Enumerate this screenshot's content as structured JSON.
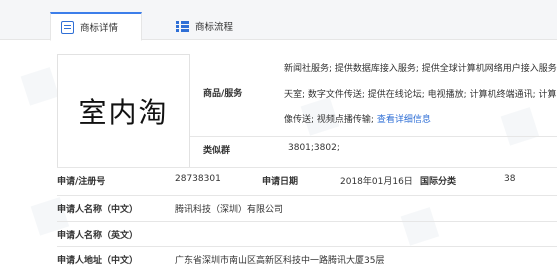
{
  "tabs": [
    {
      "label": "商标详情",
      "icon": "document-icon",
      "active": true
    },
    {
      "label": "商标流程",
      "icon": "list-icon",
      "active": false
    }
  ],
  "trademark": {
    "name_image_text": "室内淘"
  },
  "goods_services": {
    "label": "商品/服务",
    "lines": [
      "新闻社服务; 提供数据库接入服务; 提供全球计算机网络用户接入服务",
      "天室; 数字文件传送; 提供在线论坛; 电视播放; 计算机终端通讯; 计算",
      "像传送; 视频点播传输;"
    ],
    "more_link": "查看详细信息"
  },
  "similar_group": {
    "label": "类似群",
    "value": "3801;3802;"
  },
  "fields": {
    "reg_no_label": "申请/注册号",
    "reg_no": "28738301",
    "apply_date_label": "申请日期",
    "apply_date": "2018年01月16日",
    "intl_class_label": "国际分类",
    "intl_class": "38",
    "applicant_cn_label": "申请人名称（中文）",
    "applicant_cn": "腾讯科技（深圳）有限公司",
    "applicant_en_label": "申请人名称（英文）",
    "applicant_en": "",
    "address_cn_label": "申请人地址（中文）",
    "address_cn": "广东省深圳市南山区高新区科技中一路腾讯大厦35层"
  }
}
